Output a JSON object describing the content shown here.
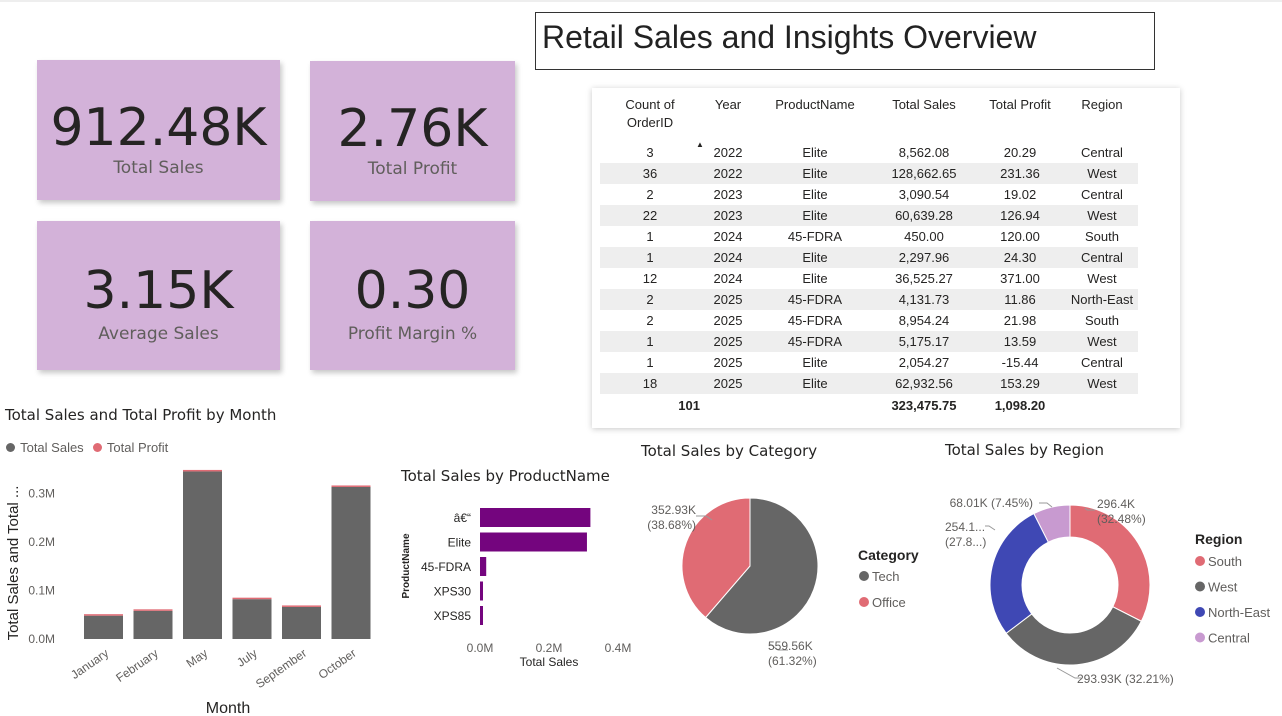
{
  "dashboard_title": "Retail Sales and Insights Overview",
  "kpis": [
    {
      "value": "912.48K",
      "label": "Total Sales"
    },
    {
      "value": "2.76K",
      "label": "Total Profit"
    },
    {
      "value": "3.15K",
      "label": "Average Sales"
    },
    {
      "value": "0.30",
      "label": "Profit Margin %"
    }
  ],
  "table": {
    "headers": [
      "Count of\nOrderID",
      "Year",
      "ProductName",
      "Total Sales",
      "Total Profit",
      "Region"
    ],
    "sort_indicator": "▲",
    "rows": [
      [
        "3",
        "2022",
        "Elite",
        "8,562.08",
        "20.29",
        "Central"
      ],
      [
        "36",
        "2022",
        "Elite",
        "128,662.65",
        "231.36",
        "West"
      ],
      [
        "2",
        "2023",
        "Elite",
        "3,090.54",
        "19.02",
        "Central"
      ],
      [
        "22",
        "2023",
        "Elite",
        "60,639.28",
        "126.94",
        "West"
      ],
      [
        "1",
        "2024",
        "45-FDRA",
        "450.00",
        "120.00",
        "South"
      ],
      [
        "1",
        "2024",
        "Elite",
        "2,297.96",
        "24.30",
        "Central"
      ],
      [
        "12",
        "2024",
        "Elite",
        "36,525.27",
        "371.00",
        "West"
      ],
      [
        "2",
        "2025",
        "45-FDRA",
        "4,131.73",
        "11.86",
        "North-East"
      ],
      [
        "2",
        "2025",
        "45-FDRA",
        "8,954.24",
        "21.98",
        "South"
      ],
      [
        "1",
        "2025",
        "45-FDRA",
        "5,175.17",
        "13.59",
        "West"
      ],
      [
        "1",
        "2025",
        "Elite",
        "2,054.27",
        "-15.44",
        "Central"
      ],
      [
        "18",
        "2025",
        "Elite",
        "62,932.56",
        "153.29",
        "West"
      ]
    ],
    "total": [
      "101",
      "",
      "",
      "323,475.75",
      "1,098.20",
      ""
    ]
  },
  "colors": {
    "kpi_bg": "#d3b2d9",
    "gray": "#666666",
    "salmon": "#e06b74",
    "purple": "#74057e",
    "blue": "#3f48b4",
    "lilac": "#c89ad0"
  },
  "chart_data": [
    {
      "type": "bar",
      "title": "Total Sales and Total Profit by Month",
      "xlabel": "Month",
      "ylabel": "Total Sales and Total ...",
      "categories": [
        "January",
        "February",
        "May",
        "July",
        "September",
        "October"
      ],
      "series": [
        {
          "name": "Total Sales",
          "values": [
            0.048,
            0.058,
            0.345,
            0.082,
            0.066,
            0.313
          ]
        },
        {
          "name": "Total Profit",
          "values": [
            0.0002,
            0.0001,
            0.0005,
            0.0002,
            0.0001,
            0.0006
          ]
        }
      ],
      "y_ticks": [
        "0.0M",
        "0.1M",
        "0.2M",
        "0.3M"
      ],
      "ylim": [
        0,
        0.35
      ],
      "legend": "top-left"
    },
    {
      "type": "bar",
      "orientation": "horizontal",
      "title": "Total Sales by ProductName",
      "xlabel": "Total Sales",
      "ylabel": "ProductName",
      "categories": [
        "â€“",
        "Elite",
        "45-FDRA",
        "XPS30",
        "XPS85"
      ],
      "values": [
        0.32,
        0.31,
        0.018,
        0.008,
        0.008
      ],
      "x_ticks": [
        "0.0M",
        "0.2M",
        "0.4M"
      ],
      "xlim": [
        0,
        0.4
      ]
    },
    {
      "type": "pie",
      "title": "Total Sales by Category",
      "legend_title": "Category",
      "labels": [
        "Tech",
        "Office"
      ],
      "values": [
        559.56,
        352.93
      ],
      "data_labels": [
        "559.56K\n(61.32%)",
        "352.93K\n(38.68%)"
      ]
    },
    {
      "type": "pie",
      "variant": "donut",
      "title": "Total Sales by Region",
      "legend_title": "Region",
      "labels": [
        "South",
        "West",
        "North-East",
        "Central"
      ],
      "values": [
        296.4,
        293.93,
        254.1,
        68.01
      ],
      "data_labels": [
        "296.4K\n(32.48%)",
        "293.93K (32.21%)",
        "254.1...\n(27.8...)",
        "68.01K (7.45%)"
      ]
    }
  ]
}
